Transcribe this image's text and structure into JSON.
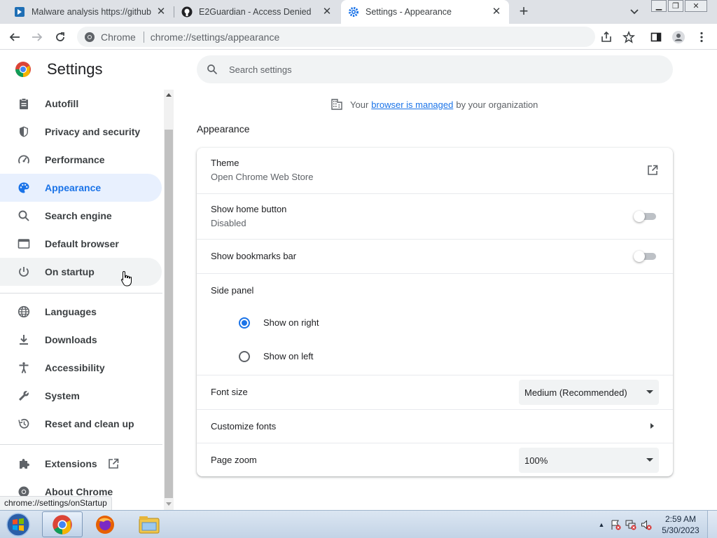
{
  "tabs": [
    {
      "title": "Malware analysis https://github.c",
      "icon": "shield-doc-icon"
    },
    {
      "title": "E2Guardian - Access Denied",
      "icon": "github-icon"
    },
    {
      "title": "Settings - Appearance",
      "icon": "gear-icon"
    }
  ],
  "toolbar": {
    "site_label": "Chrome",
    "url": "chrome://settings/appearance"
  },
  "settings": {
    "title": "Settings",
    "search_placeholder": "Search settings"
  },
  "sidebar": {
    "items": [
      {
        "label": "Autofill",
        "icon": "clipboard-icon"
      },
      {
        "label": "Privacy and security",
        "icon": "shield-icon"
      },
      {
        "label": "Performance",
        "icon": "speedometer-icon"
      },
      {
        "label": "Appearance",
        "icon": "palette-icon"
      },
      {
        "label": "Search engine",
        "icon": "search-icon"
      },
      {
        "label": "Default browser",
        "icon": "browser-icon"
      },
      {
        "label": "On startup",
        "icon": "power-icon"
      },
      {
        "label": "Languages",
        "icon": "globe-icon"
      },
      {
        "label": "Downloads",
        "icon": "download-icon"
      },
      {
        "label": "Accessibility",
        "icon": "accessibility-icon"
      },
      {
        "label": "System",
        "icon": "wrench-icon"
      },
      {
        "label": "Reset and clean up",
        "icon": "history-icon"
      },
      {
        "label": "Extensions",
        "icon": "puzzle-icon"
      },
      {
        "label": "About Chrome",
        "icon": "chrome-icon"
      }
    ]
  },
  "managed": {
    "prefix": "Your",
    "link": "browser is managed",
    "suffix": "by your organization"
  },
  "appearance": {
    "section_title": "Appearance",
    "theme_label": "Theme",
    "theme_sub": "Open Chrome Web Store",
    "home_label": "Show home button",
    "home_sub": "Disabled",
    "home_enabled": false,
    "bookmarks_label": "Show bookmarks bar",
    "bookmarks_enabled": false,
    "side_panel_label": "Side panel",
    "side_right": "Show on right",
    "side_left": "Show on left",
    "side_selected": "right",
    "font_size_label": "Font size",
    "font_size_value": "Medium (Recommended)",
    "customize_fonts_label": "Customize fonts",
    "page_zoom_label": "Page zoom",
    "page_zoom_value": "100%"
  },
  "status_bar": "chrome://settings/onStartup",
  "taskbar": {
    "time": "2:59 AM",
    "date": "5/30/2023"
  },
  "colors": {
    "accent": "#1a73e8",
    "active_nav_bg": "#e8f0fe"
  }
}
